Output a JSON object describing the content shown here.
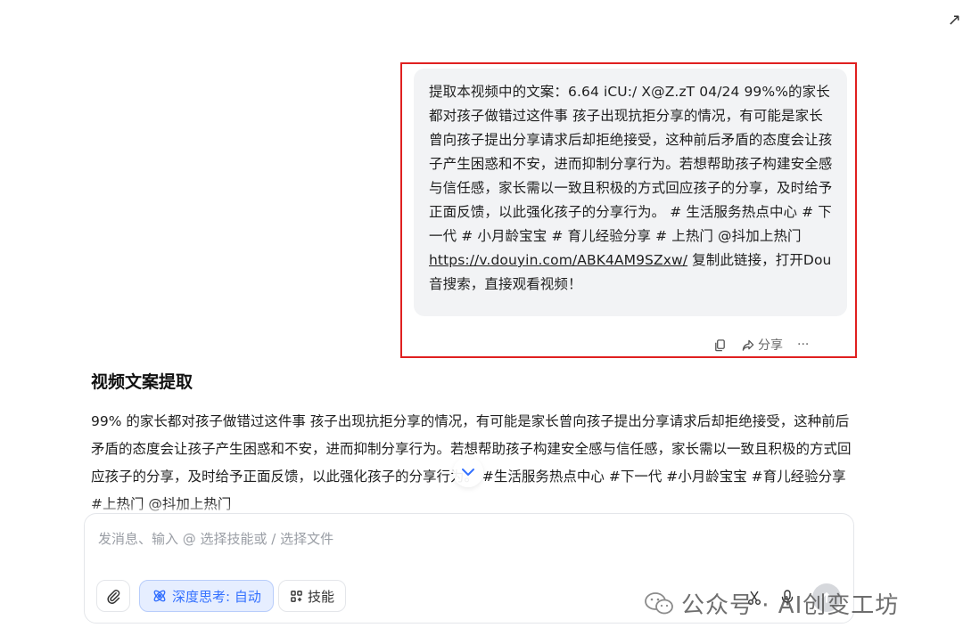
{
  "corner_glyph": "↗",
  "user_message": {
    "text_before_link": "提取本视频中的文案：6.64 iCU:/ X@Z.zT 04/24 99%%的家长都对孩子做错过这件事 孩子出现抗拒分享的情况，有可能是家长曾向孩子提出分享请求后却拒绝接受，这种前后矛盾的态度会让孩子产生困惑和不安，进而抑制分享行为。若想帮助孩子构建安全感与信任感，家长需以一致且积极的方式回应孩子的分享，及时给予正面反馈，以此强化孩子的分享行为。 # 生活服务热点中心 # 下一代 # 小月龄宝宝 # 育儿经验分享 # 上热门 @抖加上热门",
    "link": "https://v.douyin.com/ABK4AM9SZxw/",
    "text_after_link": " 复制此链接，打开Dou音搜索，直接观看视频！"
  },
  "message_actions": {
    "copy_icon": "copy-icon",
    "share_label": "分享",
    "more_label": "···"
  },
  "answer": {
    "title": "视频文案提取",
    "body": "99% 的家长都对孩子做错过这件事 孩子出现抗拒分享的情况，有可能是家长曾向孩子提出分享请求后却拒绝接受，这种前后矛盾的态度会让孩子产生困惑和不安，进而抑制分享行为。若想帮助孩子构建安全感与信任感，家长需以一致且积极的方式回应孩子的分享，及时给予正面反馈，以此强化孩子的分享行为。 #生活服务热点中心 #下一代 #小月龄宝宝 #育儿经验分享 #上热门 @抖加上热门"
  },
  "composer": {
    "placeholder": "发消息、输入 @ 选择技能或 / 选择文件",
    "deep_think_label": "深度思考: 自动",
    "skills_label": "技能"
  },
  "watermark": {
    "text": "公众号 · AI创变工坊"
  },
  "colors": {
    "accent": "#3370ff",
    "highlight_border": "#e02020",
    "bubble_bg": "#f2f3f5"
  }
}
